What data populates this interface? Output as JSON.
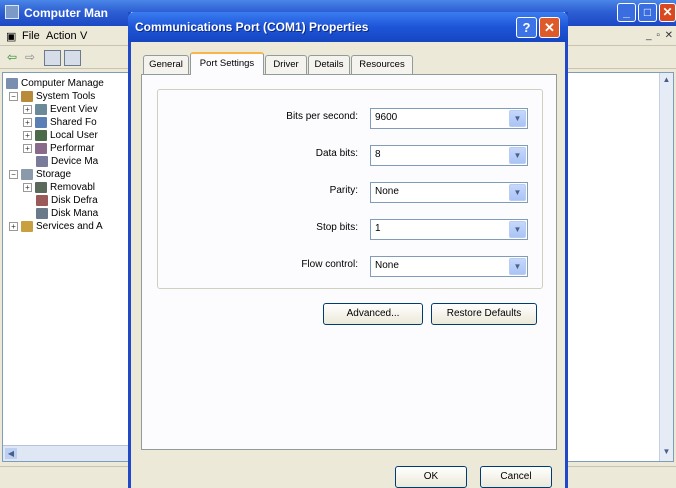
{
  "background_window": {
    "title": "Computer Man",
    "menu": [
      "File",
      "Action",
      "V"
    ],
    "tree": [
      {
        "label": "Computer Manage",
        "level": 0,
        "expander": ""
      },
      {
        "label": "System Tools",
        "level": 1,
        "expander": "−"
      },
      {
        "label": "Event Viev",
        "level": 2,
        "expander": "+"
      },
      {
        "label": "Shared Fo",
        "level": 2,
        "expander": "+"
      },
      {
        "label": "Local User",
        "level": 2,
        "expander": "+"
      },
      {
        "label": "Performar",
        "level": 2,
        "expander": "+"
      },
      {
        "label": "Device Ma",
        "level": 2,
        "expander": ""
      },
      {
        "label": "Storage",
        "level": 1,
        "expander": "−"
      },
      {
        "label": "Removabl",
        "level": 2,
        "expander": "+"
      },
      {
        "label": "Disk Defra",
        "level": 2,
        "expander": ""
      },
      {
        "label": "Disk Mana",
        "level": 2,
        "expander": ""
      },
      {
        "label": "Services and A",
        "level": 1,
        "expander": "+"
      }
    ]
  },
  "dialog": {
    "title": "Communications Port (COM1) Properties",
    "help_label": "?",
    "close_label": "✕",
    "tabs": [
      "General",
      "Port Settings",
      "Driver",
      "Details",
      "Resources"
    ],
    "active_tab": "Port Settings",
    "fields": [
      {
        "label": "Bits per second:",
        "value": "9600"
      },
      {
        "label": "Data bits:",
        "value": "8"
      },
      {
        "label": "Parity:",
        "value": "None"
      },
      {
        "label": "Stop bits:",
        "value": "1"
      },
      {
        "label": "Flow control:",
        "value": "None"
      }
    ],
    "advanced_label": "Advanced...",
    "restore_label": "Restore Defaults",
    "ok_label": "OK",
    "cancel_label": "Cancel"
  },
  "colors": {
    "title_bar": "#1d55d8",
    "close_button": "#de5a2b",
    "tab_highlight": "#f7b64c",
    "dialog_face": "#ece9d8"
  }
}
